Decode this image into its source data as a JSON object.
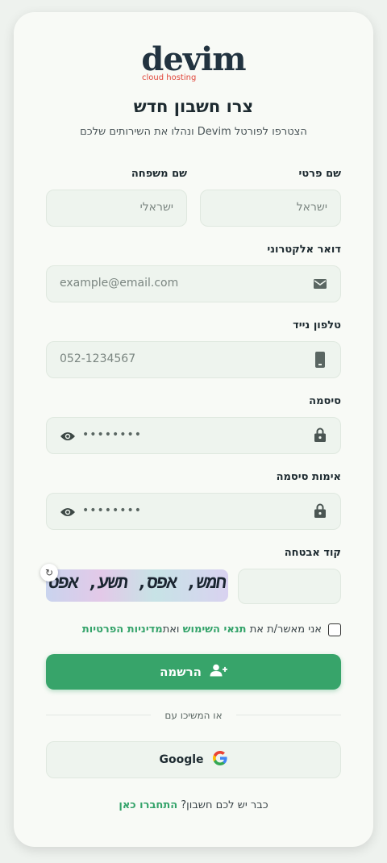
{
  "brand": {
    "name": "devim",
    "tagline": "cloud hosting"
  },
  "header": {
    "title": "צרו חשבון חדש",
    "subtitle": "הצטרפו לפורטל Devim ונהלו את השירותים שלכם"
  },
  "form": {
    "first_name": {
      "label": "שם פרטי",
      "placeholder": "ישראל"
    },
    "last_name": {
      "label": "שם משפחה",
      "placeholder": "ישראלי"
    },
    "email": {
      "label": "דואר אלקטרוני",
      "placeholder": "example@email.com",
      "icon": "mail-icon"
    },
    "phone": {
      "label": "טלפון נייד",
      "placeholder": "052-1234567",
      "icon": "phone-icon"
    },
    "password": {
      "label": "סיסמה",
      "placeholder": "••••••••",
      "icon": "lock-icon"
    },
    "password_confirm": {
      "label": "אימות סיסמה",
      "placeholder": "••••••••",
      "icon": "lock-icon"
    },
    "captcha": {
      "label": "קוד אבטחה",
      "image_text": "חמש, אפס, תשע, אפס"
    }
  },
  "terms": {
    "prefix": "אני מאשר/ת את",
    "terms_link": "תנאי השימוש",
    "and": "ואת",
    "privacy_link": "מדיניות הפרטיות"
  },
  "actions": {
    "register_label": "הרשמה",
    "divider_text": "או המשיכו עם",
    "google_label": "Google"
  },
  "footer": {
    "question": "כבר יש לכם חשבון?",
    "login_link": "התחברו כאן"
  },
  "colors": {
    "accent": "#37a46a",
    "brand_dark": "#223340",
    "brand_red": "#e0453a"
  }
}
